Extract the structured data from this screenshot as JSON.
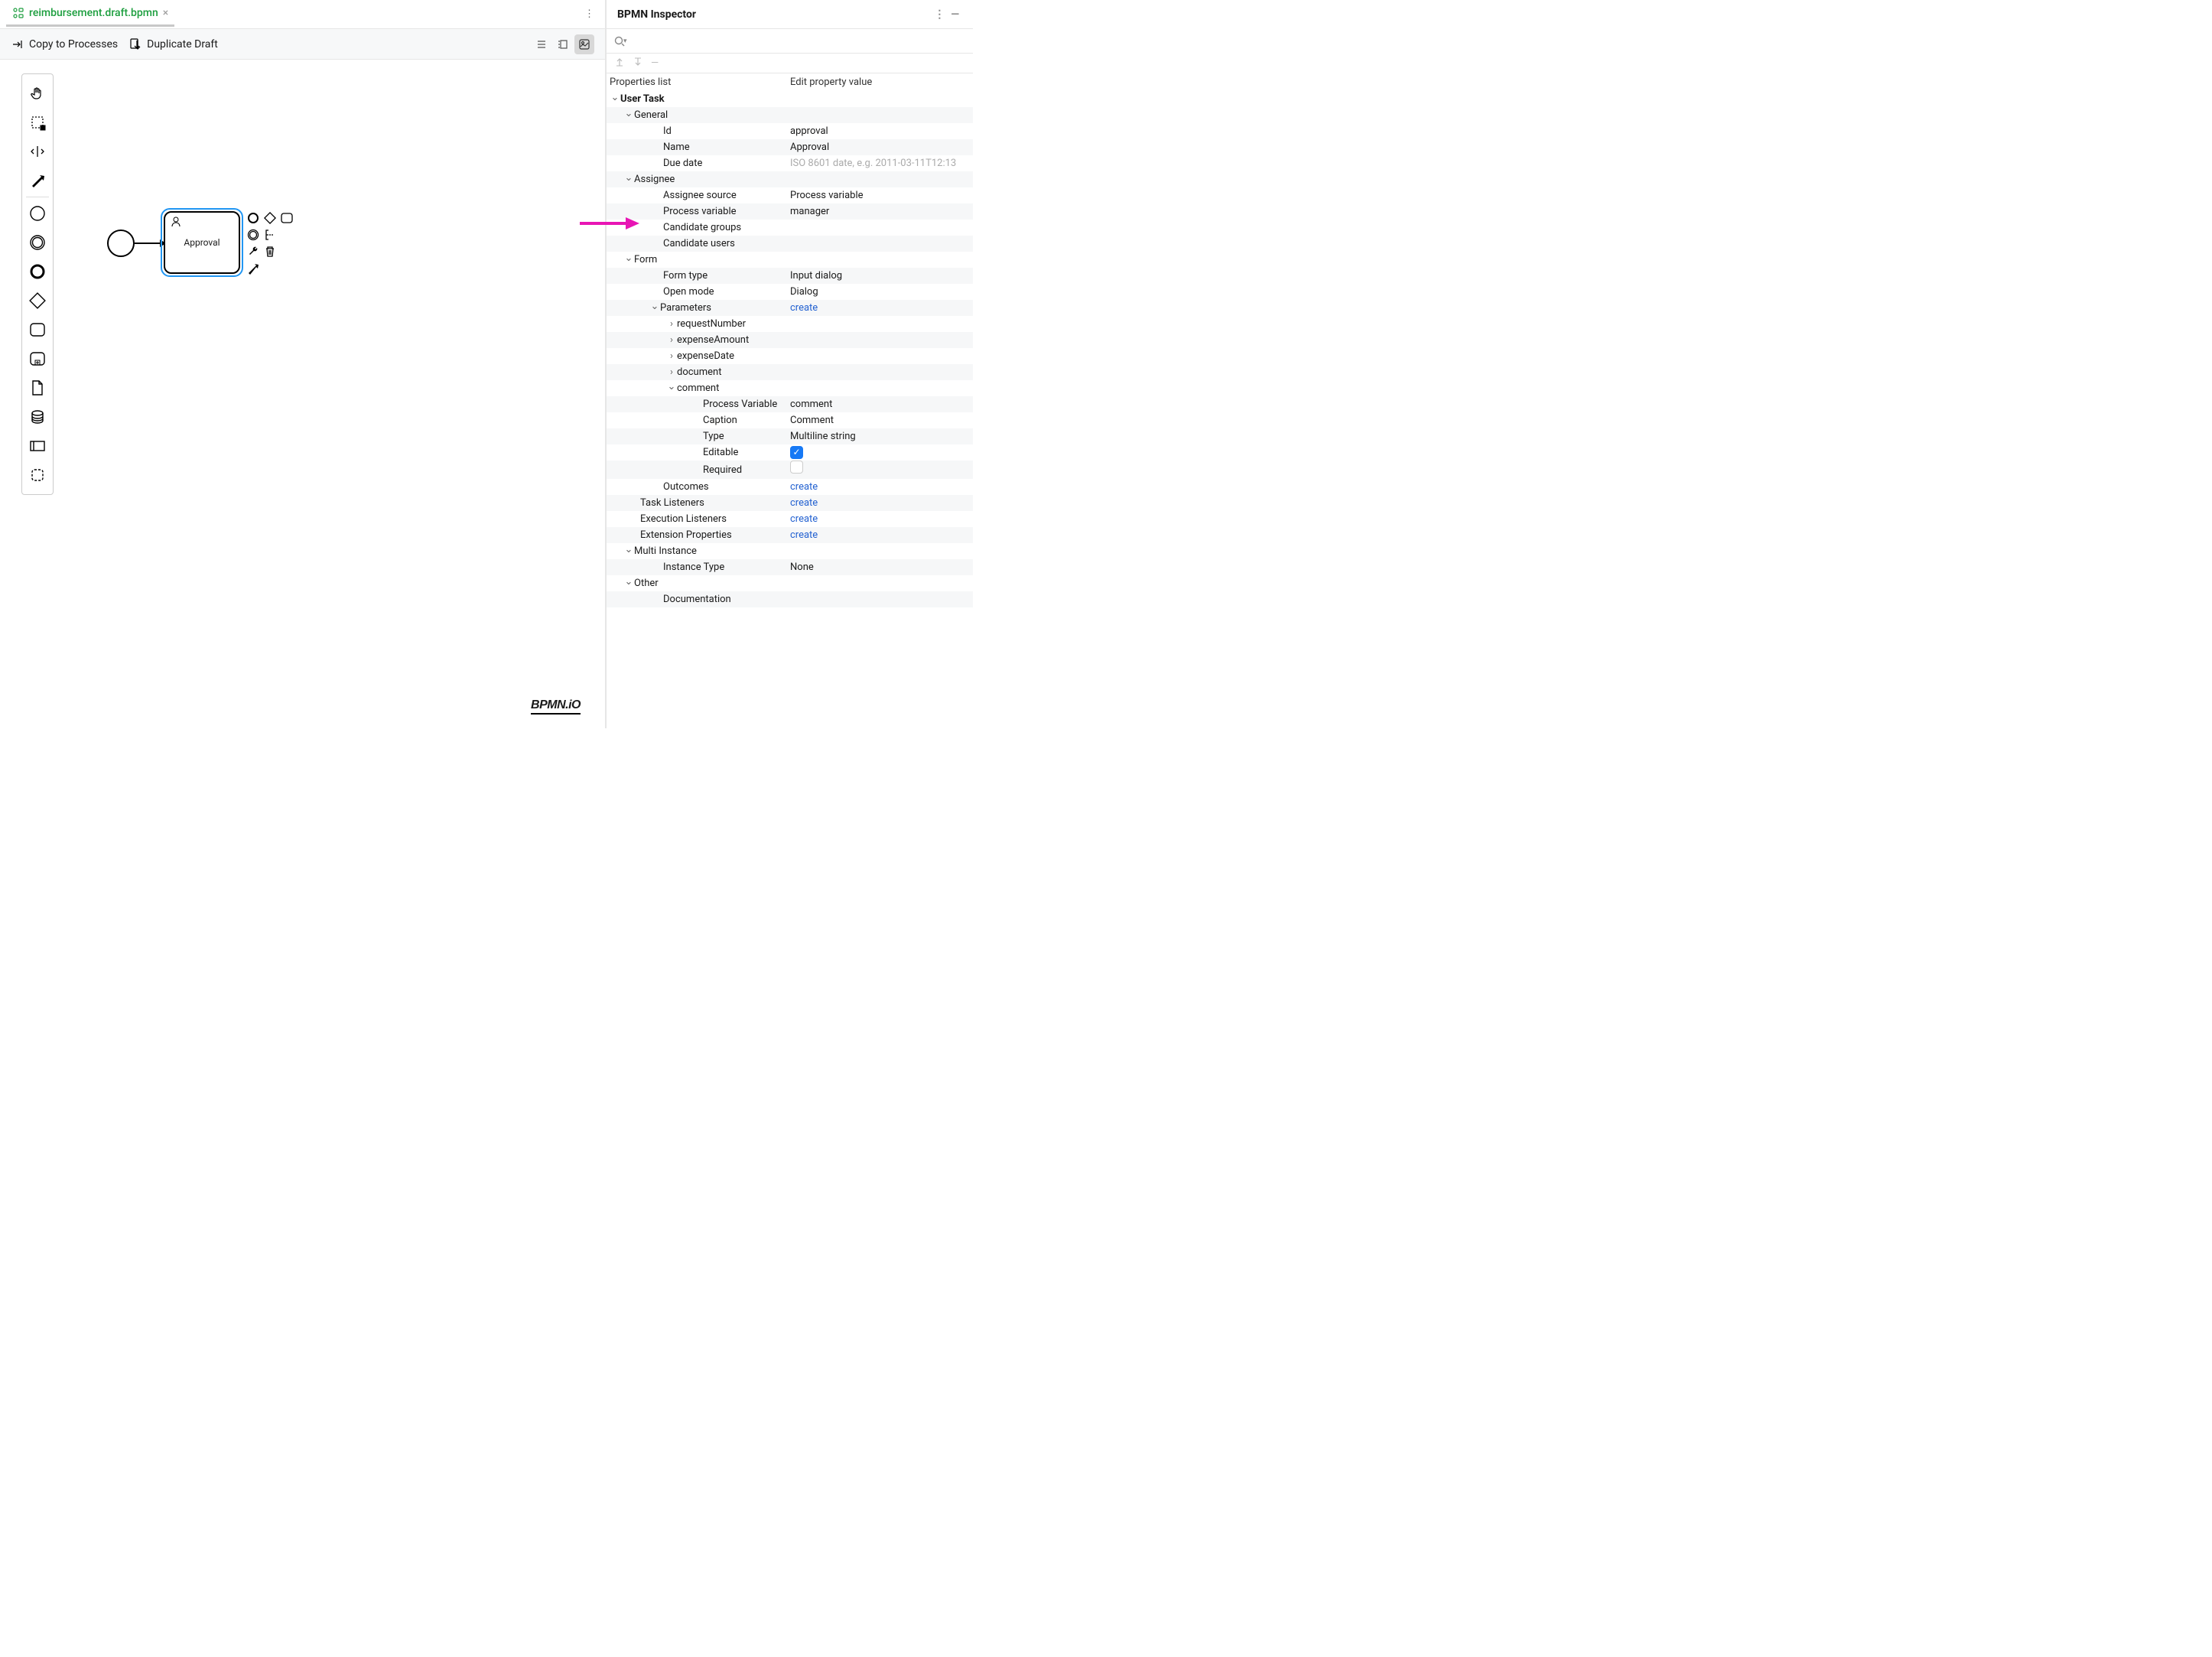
{
  "tab": {
    "label": "reimbursement.draft.bpmn"
  },
  "toolbar": {
    "copy": "Copy to Processes",
    "duplicate": "Duplicate Draft"
  },
  "canvas": {
    "task_label": "Approval",
    "watermark": "BPMN.iO"
  },
  "inspector": {
    "title": "BPMN Inspector",
    "col_left": "Properties list",
    "col_right": "Edit property value",
    "tree": {
      "root": "User Task",
      "general": {
        "label": "General",
        "id": {
          "k": "Id",
          "v": "approval"
        },
        "name": {
          "k": "Name",
          "v": "Approval"
        },
        "due_date": {
          "k": "Due date",
          "placeholder": "ISO 8601 date, e.g. 2011-03-11T12:13"
        }
      },
      "assignee": {
        "label": "Assignee",
        "source": {
          "k": "Assignee source",
          "v": "Process variable"
        },
        "pv": {
          "k": "Process variable",
          "v": "manager"
        },
        "cg": {
          "k": "Candidate groups"
        },
        "cu": {
          "k": "Candidate users"
        }
      },
      "form": {
        "label": "Form",
        "type": {
          "k": "Form type",
          "v": "Input dialog"
        },
        "open_mode": {
          "k": "Open mode",
          "v": "Dialog"
        },
        "params": {
          "label": "Parameters",
          "link": "create",
          "items": [
            "requestNumber",
            "expenseAmount",
            "expenseDate",
            "document",
            "comment"
          ],
          "comment": {
            "pv": {
              "k": "Process Variable",
              "v": "comment"
            },
            "caption": {
              "k": "Caption",
              "v": "Comment"
            },
            "type": {
              "k": "Type",
              "v": "Multiline string"
            },
            "editable": {
              "k": "Editable",
              "checked": true
            },
            "required": {
              "k": "Required",
              "checked": false
            }
          }
        },
        "outcomes": {
          "k": "Outcomes",
          "link": "create"
        },
        "task_listeners": {
          "k": "Task Listeners",
          "link": "create"
        },
        "exec_listeners": {
          "k": "Execution Listeners",
          "link": "create"
        },
        "ext_props": {
          "k": "Extension Properties",
          "link": "create"
        }
      },
      "multi": {
        "label": "Multi Instance",
        "instance_type": {
          "k": "Instance Type",
          "v": "None"
        }
      },
      "other": {
        "label": "Other",
        "doc": {
          "k": "Documentation"
        }
      }
    }
  }
}
